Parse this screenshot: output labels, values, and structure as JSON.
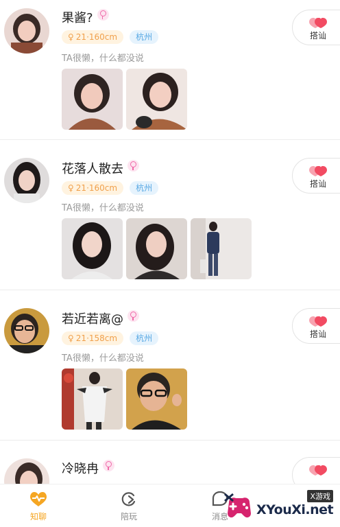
{
  "feed": {
    "users": [
      {
        "name": "果酱?",
        "info_tag": "21·160cm",
        "city": "杭州",
        "bio": "TA很懒，什么都没说",
        "photo_count": 2
      },
      {
        "name": "花落人散去",
        "info_tag": "21·160cm",
        "city": "杭州",
        "bio": "TA很懒，什么都没说",
        "photo_count": 3
      },
      {
        "name": "若近若离@",
        "info_tag": "21·158cm",
        "city": "杭州",
        "bio": "TA很懒，什么都没说",
        "photo_count": 2
      },
      {
        "name": "冷晓冉"
      }
    ],
    "greet_label": "搭讪",
    "gender_symbol": "♀"
  },
  "tabbar": {
    "tabs": [
      {
        "label": "知聊",
        "icon": "heart-wave-icon",
        "active": true
      },
      {
        "label": "陪玩",
        "icon": "game-icon",
        "active": false
      },
      {
        "label": "消息",
        "icon": "message-icon",
        "active": false
      }
    ]
  },
  "watermark": {
    "small": "X游戏",
    "big": "XYouXi.net"
  },
  "colors": {
    "accent": "#f5a623",
    "greet_heart": "#f24b62",
    "tag_info_bg": "#fff3e0",
    "tag_city_bg": "#e6f3fd"
  }
}
